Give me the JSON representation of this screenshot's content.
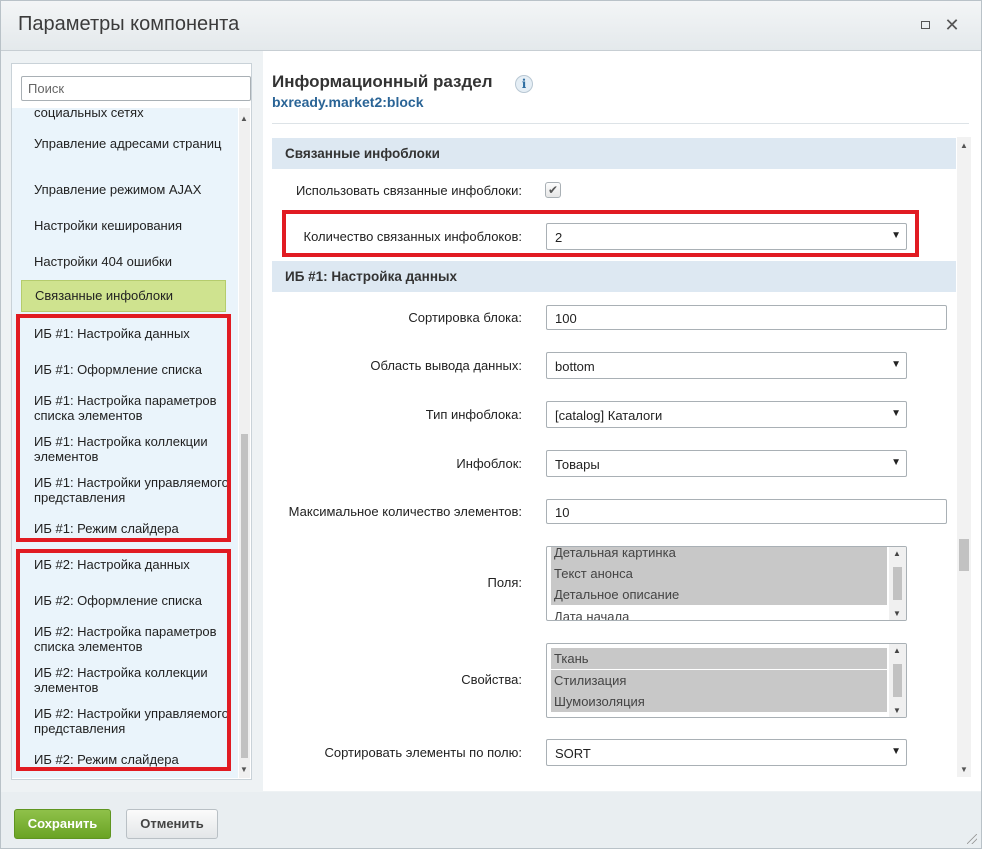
{
  "dialog": {
    "title": "Параметры компонента"
  },
  "sidebar": {
    "search_placeholder": "Поиск",
    "partial_top": "социальных сетях",
    "items": [
      {
        "label": "Управление адресами страниц"
      },
      {
        "label": "Управление режимом AJAX"
      },
      {
        "label": "Настройки кеширования"
      },
      {
        "label": "Настройки 404 ошибки"
      },
      {
        "label": "Связанные инфоблоки",
        "active": true
      },
      {
        "label": "ИБ #1: Настройка данных"
      },
      {
        "label": "ИБ #1: Оформление списка"
      },
      {
        "label": "ИБ #1: Настройка параметров списка элементов"
      },
      {
        "label": "ИБ #1: Настройка коллекции элементов"
      },
      {
        "label": "ИБ #1: Настройки управляемого представления"
      },
      {
        "label": "ИБ #1: Режим слайдера"
      },
      {
        "label": "ИБ #2: Настройка данных"
      },
      {
        "label": "ИБ #2: Оформление списка"
      },
      {
        "label": "ИБ #2: Настройка параметров списка элементов"
      },
      {
        "label": "ИБ #2: Настройка коллекции элементов"
      },
      {
        "label": "ИБ #2: Настройки управляемого представления"
      },
      {
        "label": "ИБ #2: Режим слайдера"
      }
    ]
  },
  "component": {
    "title": "Информационный раздел",
    "code": "bxready.market2:block"
  },
  "sections": {
    "linked": "Связанные инфоблоки",
    "ib1_data": "ИБ #1: Настройка данных"
  },
  "fields": {
    "use_linked": {
      "label": "Использовать связанные инфоблоки:",
      "checked": true
    },
    "linked_count": {
      "label": "Количество связанных инфоблоков:",
      "value": "2"
    },
    "block_sort": {
      "label": "Сортировка блока:",
      "value": "100"
    },
    "output_area": {
      "label": "Область вывода данных:",
      "value": "bottom"
    },
    "iblock_type": {
      "label": "Тип инфоблока:",
      "value": "[catalog] Каталоги"
    },
    "iblock": {
      "label": "Инфоблок:",
      "value": "Товары"
    },
    "max_count": {
      "label": "Максимальное количество элементов:",
      "value": "10"
    },
    "fields_list": {
      "label": "Поля:",
      "options": [
        {
          "text": "Детальная картинка",
          "selected": true
        },
        {
          "text": "Текст анонса",
          "selected": true
        },
        {
          "text": "Детальное описание",
          "selected": true
        },
        {
          "text": "Дата начала",
          "selected": false
        }
      ]
    },
    "props_list": {
      "label": "Свойства:",
      "options": [
        {
          "text": "Ткань",
          "selected": true
        },
        {
          "text": "Стилизация",
          "selected": true
        },
        {
          "text": "Шумоизоляция",
          "selected": true
        }
      ]
    },
    "sort_by": {
      "label": "Сортировать элементы по полю:",
      "value": "SORT"
    }
  },
  "footer": {
    "save_label": "Сохранить",
    "cancel_label": "Отменить"
  },
  "colors": {
    "accent_green": "#6aa324",
    "active_nav": "#cfe38f",
    "highlight_red": "#e11b22",
    "link_blue": "#2a6496"
  },
  "icons": {
    "maximize": "maximize-icon",
    "close": "close-icon",
    "info": "info-icon",
    "dropdown": "chevron-down-icon",
    "checkbox": "checkmark-icon"
  }
}
